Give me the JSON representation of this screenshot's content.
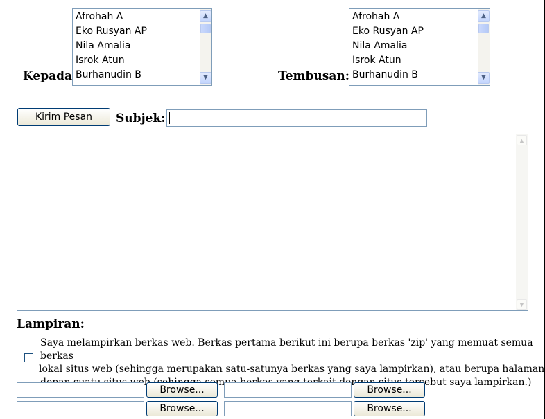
{
  "recipients": {
    "label": "Kepada:",
    "options": [
      "Afrohah A",
      "Eko Rusyan AP",
      "Nila Amalia",
      "Isrok Atun",
      "Burhanudin B"
    ]
  },
  "cc": {
    "label": "Tembusan:",
    "options": [
      "Afrohah A",
      "Eko Rusyan AP",
      "Nila Amalia",
      "Isrok Atun",
      "Burhanudin B"
    ]
  },
  "send_button_label": "Kirim Pesan",
  "subject": {
    "label": "Subjek:",
    "value": ""
  },
  "message": {
    "value": ""
  },
  "attachments": {
    "label": "Lampiran:",
    "checkbox_text_lines": [
      "Saya melampirkan berkas web. Berkas pertama berikut ini berupa berkas 'zip' yang memuat semua berkas",
      "lokal situs web (sehingga merupakan satu-satunya berkas yang saya lampirkan), atau berupa halaman",
      "depan suatu situs web (sehingga semua berkas yang terkait dengan situs tersebut saya lampirkan.)"
    ],
    "checkbox_checked": false,
    "browse_label": "Browse..."
  },
  "icons": {
    "scroll_up": "scroll-up-arrow-icon",
    "scroll_down": "scroll-down-arrow-icon"
  },
  "colors": {
    "input_border": "#7f9db9",
    "button_border": "#003c74",
    "scrollbar_blue": "#c3d5fd"
  }
}
